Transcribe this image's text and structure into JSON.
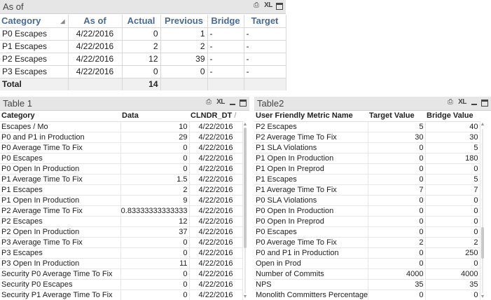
{
  "top_panel": {
    "title": "As of",
    "icons": [
      "print-icon",
      "xl-export-icon",
      "maximize-icon"
    ],
    "xl_label": "XL",
    "headers": [
      "Category",
      "As of",
      "Actual",
      "Previous",
      "Bridge",
      "Target"
    ],
    "rows": [
      [
        "P0 Escapes",
        "4/22/2016",
        "0",
        "1",
        "-",
        "-"
      ],
      [
        "P1 Escapes",
        "4/22/2016",
        "2",
        "2",
        "-",
        "-"
      ],
      [
        "P2 Escapes",
        "4/22/2016",
        "12",
        "39",
        "-",
        "-"
      ],
      [
        "P3 Escapes",
        "4/22/2016",
        "0",
        "0",
        "-",
        "-"
      ]
    ],
    "total": [
      "Total",
      "",
      "14",
      "",
      "",
      ""
    ]
  },
  "table1": {
    "title": "Table 1",
    "xl_label": "XL",
    "headers": [
      "Category",
      "Data",
      "CLNDR_DT"
    ],
    "sort_indicator": "/",
    "rows": [
      [
        "Escapes / Mo",
        "10",
        "4/22/2016"
      ],
      [
        "P0 and P1 in Production",
        "29",
        "4/22/2016"
      ],
      [
        "P0 Average Time To Fix",
        "0",
        "4/22/2016"
      ],
      [
        "P0 Escapes",
        "0",
        "4/22/2016"
      ],
      [
        "P0 Open In Production",
        "0",
        "4/22/2016"
      ],
      [
        "P1 Average Time To Fix",
        "1.5",
        "4/22/2016"
      ],
      [
        "P1 Escapes",
        "2",
        "4/22/2016"
      ],
      [
        "P1 Open In Production",
        "9",
        "4/22/2016"
      ],
      [
        "P2 Average Time To Fix",
        "0.83333333333333",
        "4/22/2016"
      ],
      [
        "P2 Escapes",
        "12",
        "4/22/2016"
      ],
      [
        "P2 Open In Production",
        "37",
        "4/22/2016"
      ],
      [
        "P3 Average Time To Fix",
        "0",
        "4/22/2016"
      ],
      [
        "P3 Escapes",
        "0",
        "4/22/2016"
      ],
      [
        "P3 Open In Production",
        "11",
        "4/22/2016"
      ],
      [
        "Security P0 Average Time To Fix",
        "0",
        "4/22/2016"
      ],
      [
        "Security P0 Escapes",
        "0",
        "4/22/2016"
      ],
      [
        "Security P1 Average Time To Fix",
        "0",
        "4/22/2016"
      ]
    ]
  },
  "table2": {
    "title": "Table2",
    "xl_label": "XL",
    "headers": [
      "User Friendly Metric Name",
      "Target Value",
      "Bridge Value"
    ],
    "rows": [
      [
        "P2 Escapes",
        "5",
        "40"
      ],
      [
        "P2 Average Time To Fix",
        "30",
        "30"
      ],
      [
        "P1 SLA Violations",
        "0",
        "5"
      ],
      [
        "P1 Open In Production",
        "0",
        "180"
      ],
      [
        "P1 Open In Preprod",
        "0",
        "0"
      ],
      [
        "P1 Escapes",
        "0",
        "5"
      ],
      [
        "P1 Average Time To Fix",
        "7",
        "7"
      ],
      [
        "P0 SLA Violations",
        "0",
        "0"
      ],
      [
        "P0 Open In Production",
        "0",
        "0"
      ],
      [
        "P0 Open In Preprod",
        "0",
        "0"
      ],
      [
        "P0 Escapes",
        "0",
        "0"
      ],
      [
        "P0 Average Time To Fix",
        "2",
        "2"
      ],
      [
        "P0 and P1 in Production",
        "0",
        "250"
      ],
      [
        "Open in Prod",
        "0",
        "0"
      ],
      [
        "Number of Commits",
        "4000",
        "4000"
      ],
      [
        "NPS",
        "35",
        "35"
      ],
      [
        "Monolith Committers Percentage",
        "0",
        "0"
      ]
    ]
  }
}
